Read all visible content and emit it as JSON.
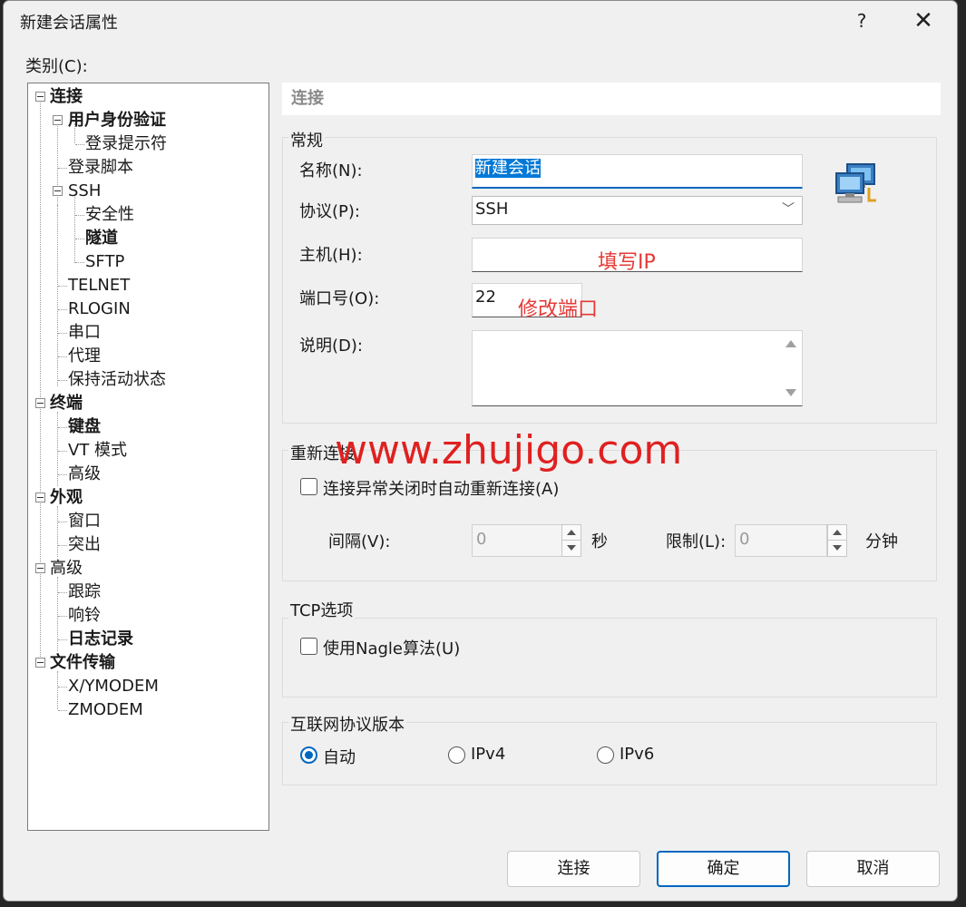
{
  "window": {
    "title": "新建会话属性",
    "help_glyph": "?",
    "close_glyph": "✕"
  },
  "category_label": "类别(C):",
  "tree": {
    "connection": "连接",
    "auth": "用户身份验证",
    "login_prompt": "登录提示符",
    "login_script": "登录脚本",
    "ssh": "SSH",
    "security": "安全性",
    "tunnel": "隧道",
    "sftp": "SFTP",
    "telnet": "TELNET",
    "rlogin": "RLOGIN",
    "serial": "串口",
    "proxy": "代理",
    "keepalive": "保持活动状态",
    "terminal": "终端",
    "keyboard": "键盘",
    "vt_mode": "VT 模式",
    "terminal_advanced": "高级",
    "appearance": "外观",
    "window": "窗口",
    "highlight": "突出",
    "advanced": "高级",
    "trace": "跟踪",
    "bell": "响铃",
    "logging": "日志记录",
    "file_transfer": "文件传输",
    "xymodem": "X/YMODEM",
    "zmodem": "ZMODEM"
  },
  "section_title": "连接",
  "general": {
    "group_label": "常规",
    "name_label": "名称(N):",
    "name_value": "新建会话",
    "protocol_label": "协议(P):",
    "protocol_value": "SSH",
    "host_label": "主机(H):",
    "host_value": "",
    "port_label": "端口号(O):",
    "port_value": "22",
    "desc_label": "说明(D):",
    "desc_value": ""
  },
  "reconnect": {
    "group_label": "重新连接",
    "checkbox_label": "连接异常关闭时自动重新连接(A)",
    "checked": false,
    "interval_label": "间隔(V):",
    "interval_value": "0",
    "seconds_unit": "秒",
    "limit_label": "限制(L):",
    "limit_value": "0",
    "minutes_unit": "分钟"
  },
  "tcp": {
    "group_label": "TCP选项",
    "nagle_label": "使用Nagle算法(U)",
    "checked": false
  },
  "ip_version": {
    "group_label": "互联网协议版本",
    "options": [
      "自动",
      "IPv4",
      "IPv6"
    ],
    "selected": "自动"
  },
  "annotations": {
    "host_hint": "填写IP",
    "port_hint": "修改端口",
    "watermark": "www.zhujigo.com"
  },
  "buttons": {
    "connect": "连接",
    "ok": "确定",
    "cancel": "取消"
  },
  "colors": {
    "accent": "#0067c0",
    "annotation": "#e53935",
    "background": "#f0f0f0"
  }
}
